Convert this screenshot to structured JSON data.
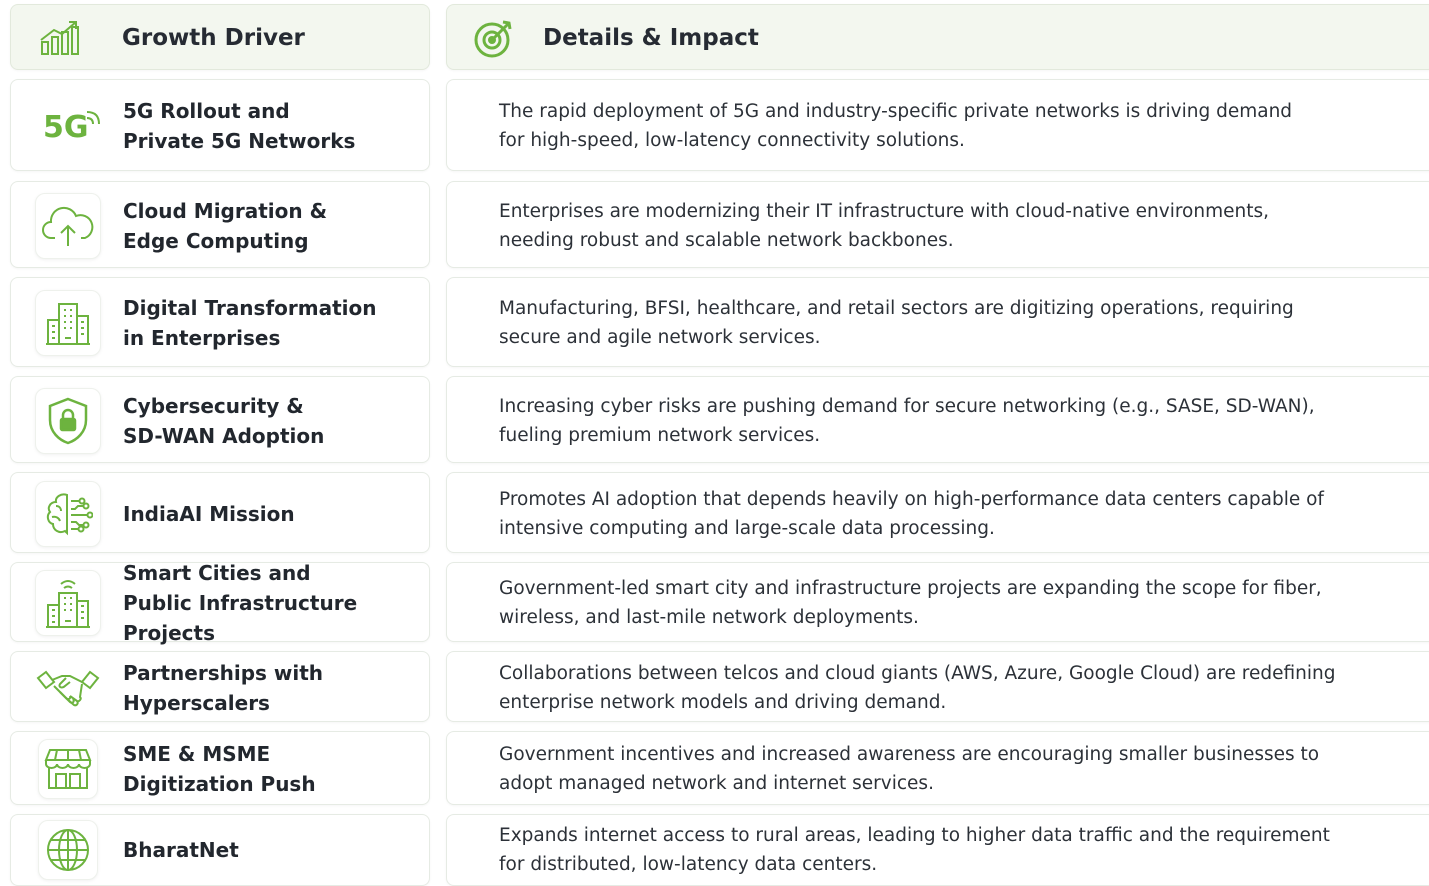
{
  "header": {
    "driver_label": "Growth Driver",
    "details_label": "Details & Impact",
    "driver_icon": "growth-chart-icon",
    "details_icon": "target-icon"
  },
  "accent_color": "#6db33f",
  "rows": [
    {
      "icon": "5g-icon",
      "icon_text": "5G",
      "driver": [
        "5G Rollout and",
        "Private 5G Networks"
      ],
      "details": [
        "The rapid deployment of 5G and industry-specific private networks is driving demand",
        "for high-speed, low-latency connectivity solutions."
      ]
    },
    {
      "icon": "cloud-upload-icon",
      "driver": [
        "Cloud Migration &",
        "Edge Computing"
      ],
      "details": [
        "Enterprises are modernizing their IT infrastructure with cloud-native environments,",
        "needing robust and scalable network backbones."
      ]
    },
    {
      "icon": "buildings-icon",
      "driver": [
        "Digital Transformation",
        "in Enterprises"
      ],
      "details": [
        "Manufacturing, BFSI, healthcare, and retail sectors are digitizing operations, requiring",
        "secure and agile network services."
      ]
    },
    {
      "icon": "shield-lock-icon",
      "driver": [
        "Cybersecurity &",
        "SD-WAN Adoption"
      ],
      "details": [
        "Increasing cyber risks are pushing demand for secure networking (e.g., SASE, SD-WAN),",
        "fueling premium network services."
      ]
    },
    {
      "icon": "ai-brain-icon",
      "driver": [
        "IndiaAI Mission"
      ],
      "details": [
        "Promotes AI adoption that depends heavily on high-performance data centers capable of",
        "intensive computing and large-scale data processing."
      ]
    },
    {
      "icon": "smart-city-icon",
      "driver": [
        "Smart Cities and",
        "Public Infrastructure Projects"
      ],
      "details": [
        "Government-led smart city and infrastructure projects are expanding the scope for fiber,",
        "wireless, and last-mile network deployments."
      ]
    },
    {
      "icon": "handshake-icon",
      "driver": [
        "Partnerships with",
        "Hyperscalers"
      ],
      "details": [
        "Collaborations between telcos and cloud giants (AWS, Azure, Google Cloud) are redefining",
        "enterprise network models and driving demand."
      ]
    },
    {
      "icon": "storefront-icon",
      "driver": [
        "SME & MSME",
        "Digitization Push"
      ],
      "details": [
        "Government incentives and increased awareness are encouraging smaller businesses to",
        "adopt managed network and internet services."
      ]
    },
    {
      "icon": "globe-icon",
      "driver": [
        "BharatNet"
      ],
      "details": [
        "Expands internet access to rural areas, leading to higher data traffic and the requirement",
        "for distributed, low-latency data centers."
      ]
    }
  ]
}
